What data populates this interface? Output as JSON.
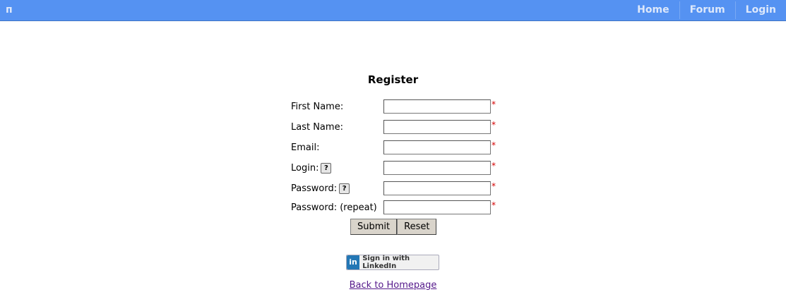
{
  "header": {
    "logo": "п",
    "nav": [
      {
        "label": "Home"
      },
      {
        "label": "Forum"
      },
      {
        "label": "Login"
      }
    ]
  },
  "form": {
    "title": "Register",
    "required_mark": "*",
    "help_mark": "?",
    "fields": [
      {
        "label": "First Name:",
        "value": ""
      },
      {
        "label": "Last Name:",
        "value": ""
      },
      {
        "label": "Email:",
        "value": ""
      },
      {
        "label": "Login:",
        "value": ""
      },
      {
        "label": "Password:",
        "value": ""
      },
      {
        "label": "Password: (repeat)",
        "value": ""
      }
    ],
    "submit_label": "Submit",
    "reset_label": "Reset"
  },
  "linkedin": {
    "icon_text": "in",
    "label": "Sign in with LinkedIn"
  },
  "footer": {
    "back_link": "Back to Homepage"
  }
}
